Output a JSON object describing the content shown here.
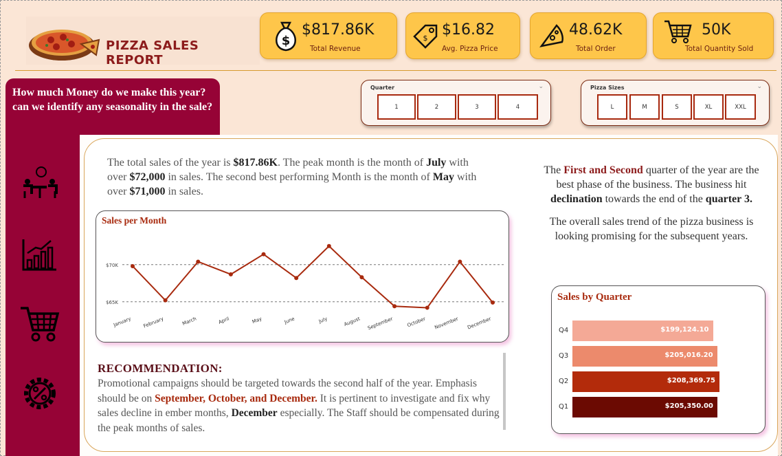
{
  "header": {
    "title": "PIZZA SALES REPORT",
    "kpis": [
      {
        "value": "$817.86K",
        "label": "Total Revenue",
        "icon": "money-bag-icon"
      },
      {
        "value": "$16.82",
        "label": "Avg. Pizza Price",
        "icon": "price-tag-icon"
      },
      {
        "value": "48.62K",
        "label": "Total Order",
        "icon": "pizza-slice-icon"
      },
      {
        "value": "50K",
        "label": "Total Quantity Sold",
        "icon": "shopping-cart-icon"
      }
    ]
  },
  "question": "How much Money do we make this year?  can we identify any seasonality in the sale?",
  "slicers": {
    "quarter": {
      "title": "Quarter",
      "options": [
        "1",
        "2",
        "3",
        "4"
      ]
    },
    "sizes": {
      "title": "Pizza Sizes",
      "options": [
        "L",
        "M",
        "S",
        "XL",
        "XXL"
      ]
    }
  },
  "summary": {
    "p1": "The total sales of the year is ",
    "total": "$817.86K",
    "p2": ". The peak month is the month of ",
    "peak_month": "July",
    "p3": " with over ",
    "peak_value": "$72,000",
    "p4": " in sales. The second best performing Month is the month of ",
    "second_month": "May",
    "p5": " with over ",
    "second_value": "$71,000",
    "p6": " in sales."
  },
  "chart_data": [
    {
      "type": "line",
      "title": "Sales per Month",
      "categories": [
        "January",
        "February",
        "March",
        "April",
        "May",
        "June",
        "July",
        "August",
        "September",
        "October",
        "November",
        "December"
      ],
      "values": [
        69800,
        65200,
        70400,
        68700,
        71400,
        68200,
        72500,
        68300,
        64400,
        64200,
        70400,
        64900
      ],
      "yticks": [
        "$65K",
        "$70K"
      ],
      "ylim": [
        63500,
        73500
      ],
      "color": "#a82a0e"
    },
    {
      "type": "bar",
      "title": "Sales by Quarter",
      "categories": [
        "Q4",
        "Q3",
        "Q2",
        "Q1"
      ],
      "values": [
        199124.1,
        205016.2,
        208369.75,
        205350.0
      ],
      "labels": [
        "$199,124.10",
        "$205,016.20",
        "$208,369.75",
        "$205,350.00"
      ],
      "colors": [
        "#f4a996",
        "#ec8a6c",
        "#b32b0b",
        "#6b0a02"
      ]
    }
  ],
  "analysis": {
    "a1": "The ",
    "a_red": "First and Second",
    "a2": " quarter of the year are the best phase of the business. The business hit ",
    "a_bold1": "declination",
    "a3": " towards the end of the ",
    "a_bold2": "quarter 3.",
    "p2": "The overall sales trend of the pizza business is looking promising for the subsequent years."
  },
  "recommendation": {
    "title": "RECOMMENDATION:",
    "t1": " Promotional campaigns should be targeted towards the second half of the year. Emphasis should be on ",
    "hl": "September, October, and December.",
    "t2": " It is pertinent to investigate and fix why sales decline in ember months, ",
    "bold": "December",
    "t3": " especially. The Staff should be compensated during the peak months of sales."
  },
  "colors": {
    "accent": "#960336",
    "kpi": "#fec64a",
    "line": "#a82a0e"
  }
}
